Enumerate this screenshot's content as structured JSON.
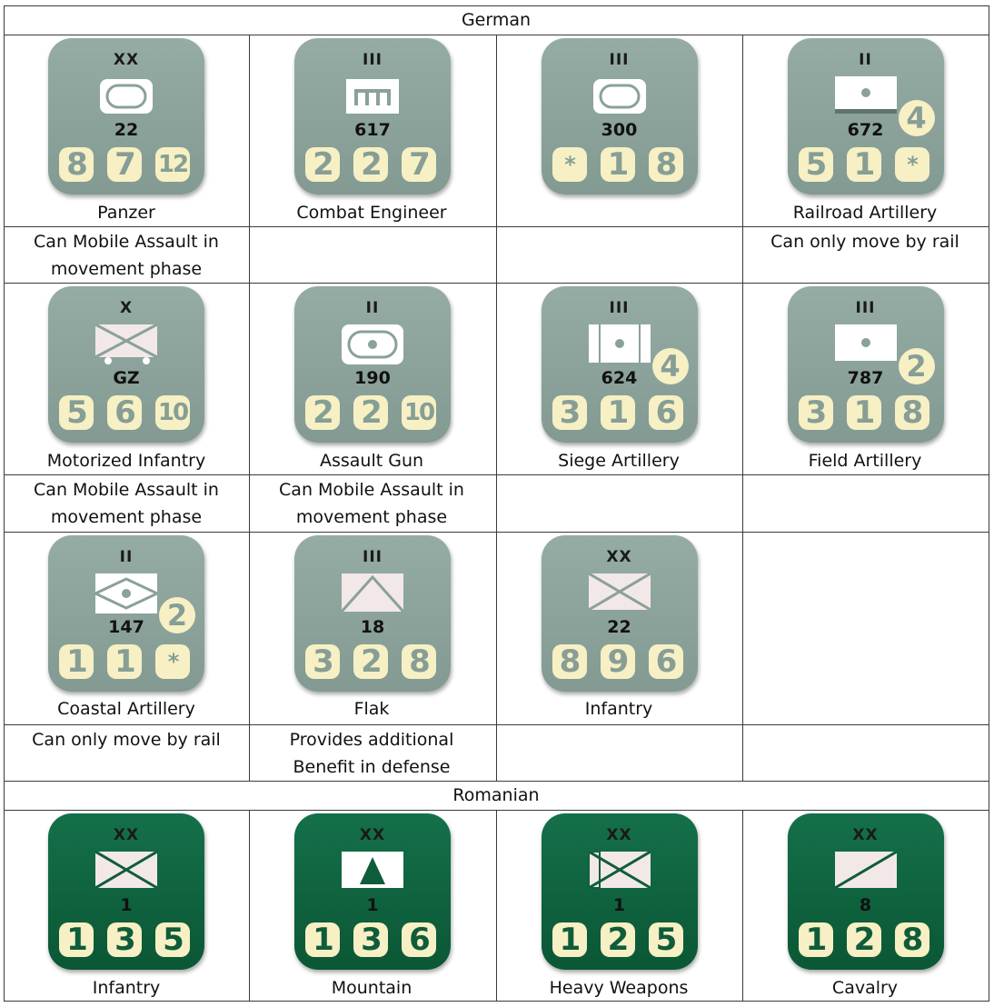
{
  "sections": {
    "german": "German",
    "romanian": "Romanian"
  },
  "units": [
    {
      "label": "Panzer",
      "size": "XX",
      "id": "22",
      "factors": [
        "8",
        "7",
        "12"
      ],
      "badge": null,
      "symbol": "panzer",
      "note": [
        "Can Mobile Assault in",
        "movement phase"
      ]
    },
    {
      "label": "Combat Engineer",
      "size": "III",
      "id": "617",
      "factors": [
        "2",
        "2",
        "7"
      ],
      "badge": null,
      "symbol": "engineer",
      "note": null
    },
    {
      "label": "",
      "size": "III",
      "id": "300",
      "factors": [
        "*",
        "1",
        "8"
      ],
      "badge": null,
      "symbol": "panzer",
      "note": null
    },
    {
      "label": "Railroad Artillery",
      "size": "II",
      "id": "672",
      "factors": [
        "5",
        "1",
        "*"
      ],
      "badge": "4",
      "symbol": "railroad-artillery",
      "note": [
        "Can only move by rail"
      ]
    },
    {
      "label": "Motorized Infantry",
      "size": "X",
      "id": "GZ",
      "factors": [
        "5",
        "6",
        "10"
      ],
      "badge": null,
      "symbol": "motorized-infantry",
      "note": [
        "Can Mobile Assault in",
        "movement phase"
      ]
    },
    {
      "label": "Assault Gun",
      "size": "II",
      "id": "190",
      "factors": [
        "2",
        "2",
        "10"
      ],
      "badge": null,
      "symbol": "assault-gun",
      "note": [
        "Can Mobile Assault in",
        "movement phase"
      ]
    },
    {
      "label": "Siege Artillery",
      "size": "III",
      "id": "624",
      "factors": [
        "3",
        "1",
        "6"
      ],
      "badge": "4",
      "symbol": "siege-artillery",
      "note": null
    },
    {
      "label": "Field Artillery",
      "size": "III",
      "id": "787",
      "factors": [
        "3",
        "1",
        "8"
      ],
      "badge": "2",
      "symbol": "field-artillery",
      "note": null
    },
    {
      "label": "Coastal Artillery",
      "size": "II",
      "id": "147",
      "factors": [
        "1",
        "1",
        "*"
      ],
      "badge": "2",
      "symbol": "coastal-artillery",
      "note": [
        "Can only move by rail"
      ]
    },
    {
      "label": "Flak",
      "size": "III",
      "id": "18",
      "factors": [
        "3",
        "2",
        "8"
      ],
      "badge": null,
      "symbol": "flak",
      "note": [
        "Provides additional",
        "Benefit in defense"
      ]
    },
    {
      "label": "Infantry",
      "size": "XX",
      "id": "22",
      "factors": [
        "8",
        "9",
        "6"
      ],
      "badge": null,
      "symbol": "infantry",
      "note": null
    },
    {
      "label": "Infantry",
      "size": "XX",
      "id": "1",
      "factors": [
        "1",
        "3",
        "5"
      ],
      "badge": null,
      "symbol": "infantry",
      "note": null
    },
    {
      "label": "Mountain",
      "size": "XX",
      "id": "1",
      "factors": [
        "1",
        "3",
        "6"
      ],
      "badge": null,
      "symbol": "mountain",
      "note": null
    },
    {
      "label": "Heavy Weapons",
      "size": "XX",
      "id": "1",
      "factors": [
        "1",
        "2",
        "5"
      ],
      "badge": null,
      "symbol": "heavy-weapons",
      "note": null
    },
    {
      "label": "Cavalry",
      "size": "XX",
      "id": "8",
      "factors": [
        "1",
        "2",
        "8"
      ],
      "badge": null,
      "symbol": "cavalry",
      "note": null
    }
  ],
  "colors": {
    "german_counter": "#8aa199",
    "romanian_counter": "#0f5c3b",
    "factor_box": "#f6f0c4"
  }
}
